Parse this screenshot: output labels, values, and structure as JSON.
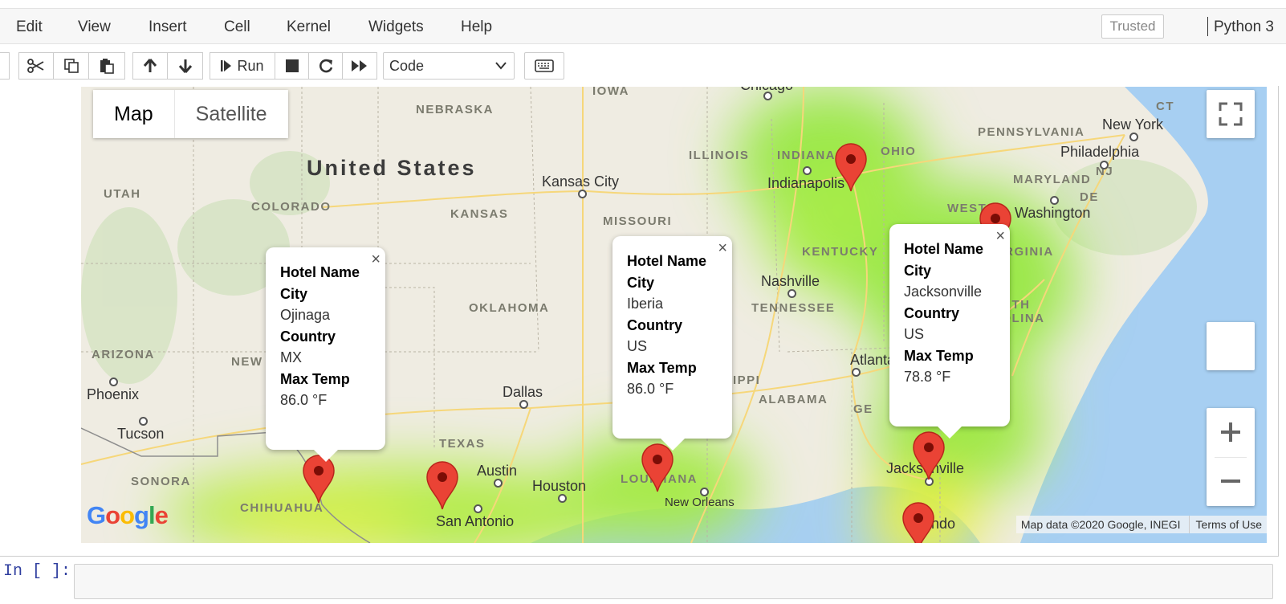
{
  "menu": {
    "items": [
      "Edit",
      "View",
      "Insert",
      "Cell",
      "Kernel",
      "Widgets",
      "Help"
    ],
    "trusted": "Trusted",
    "kernel": "Python 3"
  },
  "toolbar": {
    "run_label": "Run",
    "cell_type": "Code"
  },
  "map": {
    "type_control": {
      "map": "Map",
      "satellite": "Satellite"
    },
    "country_label": "United States",
    "state_labels": [
      "IOWA",
      "NEBRASKA",
      "UTAH",
      "COLORADO",
      "KANSAS",
      "MISSOURI",
      "ILLINOIS",
      "INDIANA",
      "OHIO",
      "PENNSYLVANIA",
      "MARYLAND",
      "NJ",
      "DE",
      "CT",
      "WEST",
      "VIRGINIA",
      "KENTUCKY",
      "TENNESSEE",
      "ORTH",
      "ROLINA",
      "OKLAHOMA",
      "ARIZONA",
      "NEW",
      "TEXAS",
      "SONORA",
      "CHIHUAHUA",
      "ALABAMA",
      "SSIPPI",
      "LOUISIANA",
      "GE",
      "A"
    ],
    "city_labels": [
      "Chicago",
      "Kansas City",
      "Indianapolis",
      "Washington",
      "New York",
      "Philadelphia",
      "Nashville",
      "Atlanta",
      "Phoenix",
      "Tucson",
      "Dallas",
      "Austin",
      "Houston",
      "San Antonio",
      "New Orleans",
      "Jacksonville",
      "ando"
    ],
    "popups": [
      {
        "h1": "Hotel Name",
        "h2": "City",
        "city": "Ojinaga",
        "h3": "Country",
        "country": "MX",
        "h4": "Max Temp",
        "temp": "86.0 °F"
      },
      {
        "h1": "Hotel Name",
        "h2": "City",
        "city": "Iberia",
        "h3": "Country",
        "country": "US",
        "h4": "Max Temp",
        "temp": "86.0 °F"
      },
      {
        "h1": "Hotel Name",
        "h2": "City",
        "city": "Jacksonville",
        "h3": "Country",
        "country": "US",
        "h4": "Max Temp",
        "temp": "78.8 °F"
      }
    ],
    "logo": "Google",
    "attribution": "Map data ©2020 Google, INEGI",
    "terms": "Terms of Use",
    "close_glyph": "×"
  },
  "cell": {
    "prompt": "In [ ]:"
  },
  "colors": {
    "marker": "#ea4335",
    "heat_green": "#9be84a",
    "heat_yellow": "#e6f04a",
    "water": "#a7cff2",
    "prompt": "#303f9f"
  }
}
